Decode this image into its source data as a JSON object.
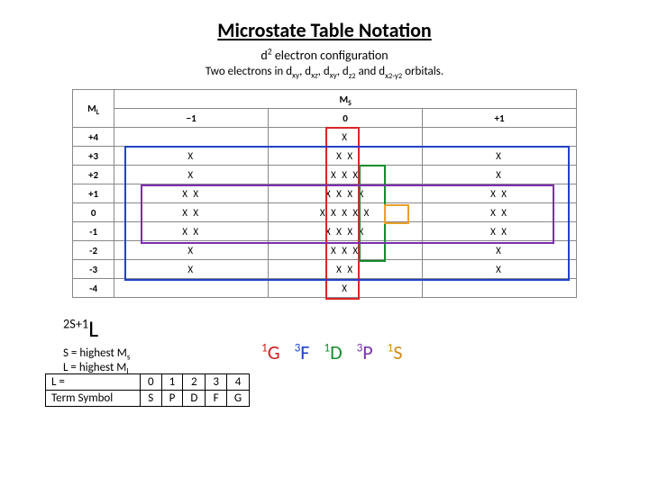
{
  "title": "Microstate Table Notation",
  "config_line": "d² electron configuration",
  "orbitals_line_prefix": "Two electrons in d",
  "orbitals_line_suffix": " orbitals.",
  "orbital_subs": [
    "xy",
    "xz",
    "xy",
    "z²",
    "x²-y²"
  ],
  "headers": {
    "ML": "M_L",
    "MS": "M_S",
    "ms_values": [
      "−1",
      "0",
      "+1"
    ]
  },
  "chart_data": {
    "type": "table",
    "title": "Microstate distribution for d² configuration",
    "xlabel": "M_S",
    "ylabel": "M_L",
    "ms_values": [
      -1,
      0,
      1
    ],
    "ml_values": [
      4,
      3,
      2,
      1,
      0,
      -1,
      -2,
      -3,
      -4
    ],
    "counts": [
      [
        0,
        1,
        0
      ],
      [
        1,
        2,
        1
      ],
      [
        1,
        3,
        1
      ],
      [
        2,
        4,
        2
      ],
      [
        2,
        5,
        2
      ],
      [
        2,
        4,
        2
      ],
      [
        1,
        3,
        1
      ],
      [
        1,
        2,
        1
      ],
      [
        0,
        1,
        0
      ]
    ],
    "term_boxes": [
      {
        "term": "1G",
        "color": "#d92626",
        "ml_range": [
          4,
          -4
        ],
        "ms_range": [
          0,
          0
        ]
      },
      {
        "term": "3F",
        "color": "#2142c7",
        "ml_range": [
          3,
          -3
        ],
        "ms_range": [
          -1,
          1
        ]
      },
      {
        "term": "1D",
        "color": "#158c2e",
        "ml_range": [
          2,
          -2
        ],
        "ms_range": [
          0,
          0
        ]
      },
      {
        "term": "3P",
        "color": "#7a2fb0",
        "ml_range": [
          1,
          -1
        ],
        "ms_range": [
          -1,
          1
        ]
      },
      {
        "term": "1S",
        "color": "#e8a02a",
        "ml_range": [
          0,
          0
        ],
        "ms_range": [
          0,
          0
        ]
      }
    ]
  },
  "term_formula": {
    "prefix": "2S+1",
    "L": "L"
  },
  "term_rules": {
    "s_line": "S = highest M",
    "s_sub": "s",
    "l_line": "L = highest M",
    "l_sub": "l"
  },
  "legend": {
    "row1_label": "L =",
    "row1": [
      "0",
      "1",
      "2",
      "3",
      "4"
    ],
    "row2_label": "Term Symbol",
    "row2": [
      "S",
      "P",
      "D",
      "F",
      "G"
    ]
  },
  "terms_list": [
    {
      "sup": "1",
      "L": "G",
      "cls": "tl-red"
    },
    {
      "sup": "3",
      "L": "F",
      "cls": "tl-blue"
    },
    {
      "sup": "1",
      "L": "D",
      "cls": "tl-green"
    },
    {
      "sup": "3",
      "L": "P",
      "cls": "tl-purple"
    },
    {
      "sup": "1",
      "L": "S",
      "cls": "tl-orange"
    }
  ]
}
